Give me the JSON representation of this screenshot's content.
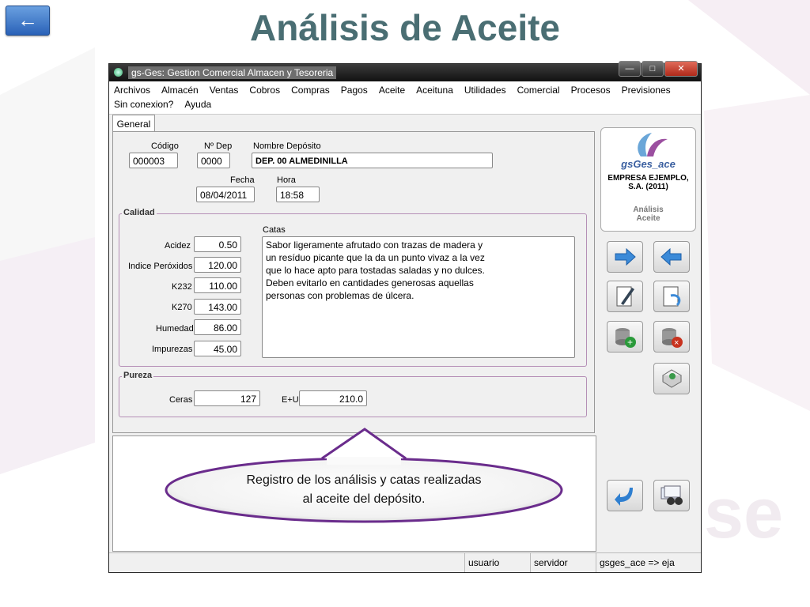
{
  "slide": {
    "title": "Análisis de Aceite"
  },
  "window": {
    "title": "gs-Ges: Gestion Comercial Almacen y Tesoreria",
    "menu_row1": [
      "Archivos",
      "Almacén",
      "Ventas",
      "Cobros",
      "Compras",
      "Pagos",
      "Aceite",
      "Aceituna",
      "Utilidades",
      "Comercial",
      "Procesos",
      "Previsiones"
    ],
    "menu_row2": [
      "Sin conexion?",
      "Ayuda"
    ]
  },
  "tab": {
    "label": "General"
  },
  "header": {
    "codigo_label": "Código",
    "codigo": "000003",
    "ndep_label": "Nº Dep",
    "ndep": "0000",
    "nombre_label": "Nombre Depósito",
    "nombre": "DEP. 00 ALMEDINILLA",
    "fecha_label": "Fecha",
    "fecha": "08/04/2011",
    "hora_label": "Hora",
    "hora": "18:58"
  },
  "calidad": {
    "title": "Calidad",
    "acidez_label": "Acidez",
    "acidez": "0.50",
    "peroxidos_label": "Indice Peróxidos",
    "peroxidos": "120.00",
    "k232_label": "K232",
    "k232": "110.00",
    "k270_label": "K270",
    "k270": "143.00",
    "humedad_label": "Humedad",
    "humedad": "86.00",
    "impurezas_label": "Impurezas",
    "impurezas": "45.00",
    "catas_label": "Catas",
    "catas": "Sabor ligeramente afrutado con trazas de madera y\nun resíduo picante que la da un punto vivaz a la vez\nque lo hace apto para tostadas saladas y no dulces.\nDeben evitarlo en cantidades generosas aquellas\npersonas con problemas de úlcera."
  },
  "pureza": {
    "title": "Pureza",
    "ceras_label": "Ceras",
    "ceras": "127",
    "eu_label": "E+U",
    "eu": "210.0"
  },
  "logo": {
    "name": "gsGes_ace",
    "company": "EMPRESA EJEMPLO,\nS.A. (2011)",
    "subtitle": "Análisis\nAceite"
  },
  "status": {
    "usuario": "usuario",
    "servidor": "servidor",
    "info": "gsges_ace => eja"
  },
  "callout": {
    "text": "Registro de los análisis y catas realizadas\nal aceite del depósito."
  },
  "colors": {
    "title": "#4a6e73",
    "group_border": "#b58fb6",
    "callout_border": "#6a2c8c"
  },
  "icons": [
    "back-arrow-icon",
    "forward-arrow-icon",
    "backward-arrow-icon",
    "edit-document-icon",
    "undo-document-icon",
    "add-record-icon",
    "delete-record-icon",
    "print-icon",
    "return-icon",
    "search-binoculars-icon"
  ]
}
